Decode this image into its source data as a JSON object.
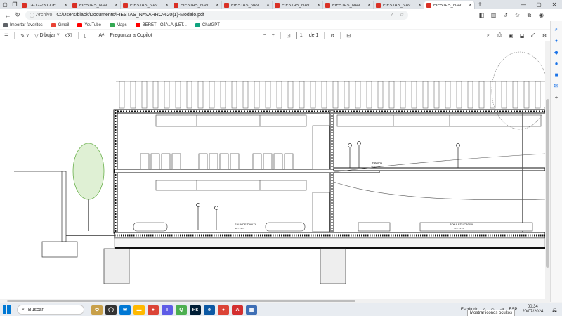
{
  "tabs": [
    {
      "label": "14-12-23 CORTES",
      "active": false
    },
    {
      "label": "FIESTAS_NAVARRO",
      "active": false
    },
    {
      "label": "FIESTAS_NAVARRO",
      "active": false
    },
    {
      "label": "FIESTAS_NAVARRO",
      "active": false
    },
    {
      "label": "FIESTAS_NAVARRO",
      "active": false
    },
    {
      "label": "FIESTAS_NAVARRO",
      "active": false
    },
    {
      "label": "FIESTAS_NAVARRO",
      "active": false
    },
    {
      "label": "FIESTAS_NAVARRO",
      "active": false
    },
    {
      "label": "FIESTAS_NAVARRO",
      "active": true
    }
  ],
  "address": {
    "scheme_label": "Archivo",
    "url": "C:/Users/black/Documents/FIESTAS_NAVARRO%20(1)-Modelo.pdf"
  },
  "bookmarks": [
    {
      "label": "Importar favoritos",
      "color": "#5f6368"
    },
    {
      "label": "Gmail",
      "color": "#ea4335"
    },
    {
      "label": "YouTube",
      "color": "#ff0000"
    },
    {
      "label": "Maps",
      "color": "#34a853"
    },
    {
      "label": "BERET - OJALÁ (LET...",
      "color": "#ff0000"
    },
    {
      "label": "ChatGPT",
      "color": "#10a37f"
    }
  ],
  "pdf_toolbar": {
    "draw_label": "Dibujar",
    "copilot_label": "Preguntar a Copilot",
    "page_current": "1",
    "page_total": "de 1"
  },
  "drawing_labels": {
    "sala_danza": "SALA DE DANZA",
    "sala_danza_level": "NPT: -3.70",
    "zona_educativa": "ZONA EDUCATIVA",
    "zona_level": "NPT: -3.70",
    "rampa": "RAMPA",
    "rampa_level": "NPT: 1.70"
  },
  "taskbar": {
    "search_placeholder": "Buscar",
    "desktop_label": "Escritorio",
    "lang": "ESP",
    "time": "00:34",
    "date": "20/07/2024",
    "tooltip": "Mostrar iconos ocultos"
  }
}
